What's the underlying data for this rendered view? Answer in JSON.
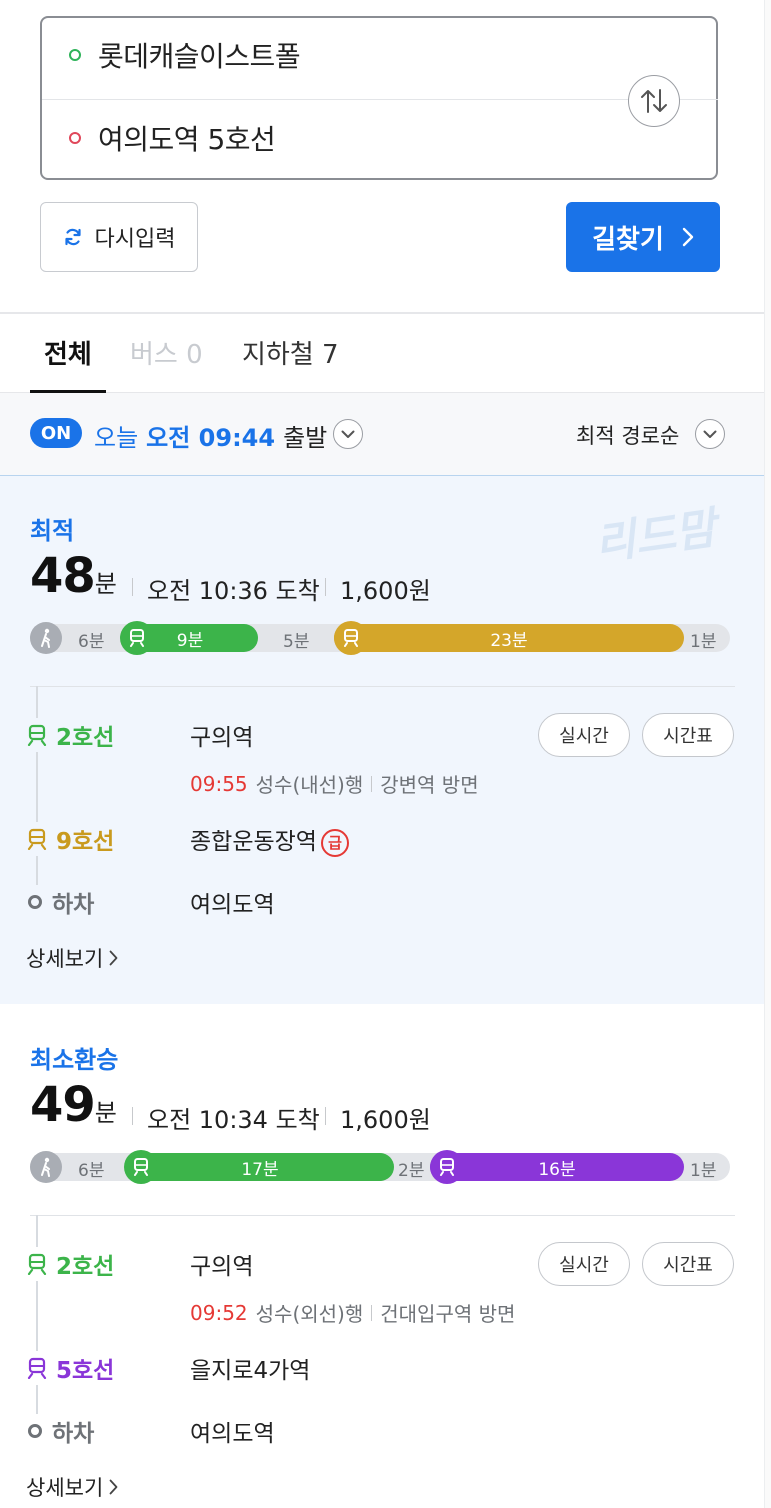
{
  "search": {
    "origin": "롯데캐슬이스트폴",
    "destination": "여의도역 5호선",
    "reset_label": "다시입력",
    "search_label": "길찾기"
  },
  "tabs": [
    {
      "label": "전체",
      "active": true
    },
    {
      "label": "버스 0",
      "active": false,
      "disabled": true
    },
    {
      "label": "지하철 7",
      "active": false
    }
  ],
  "departure": {
    "badge": "ON",
    "day": "오늘",
    "time": "오전 09:44",
    "suffix": "출발",
    "sort": "최적 경로순"
  },
  "watermark": "리드맘",
  "routes": [
    {
      "type": "최적",
      "minutes": "48",
      "unit": "분",
      "arrival": "오전 10:36 도착",
      "fare": "1,600원",
      "timeline": {
        "walk_start": "6분",
        "legs": [
          {
            "line": "2호선",
            "label": "9분",
            "color": "#3cb44a"
          },
          {
            "gap": "5분"
          },
          {
            "line": "9호선",
            "label": "23분",
            "color": "#d4a62a"
          }
        ],
        "walk_end": "1분"
      },
      "steps": [
        {
          "line": "2호선",
          "color": "#3cb44a",
          "station": "구의역",
          "detail_time": "09:55",
          "detail_text": "성수(내선)행",
          "direction": "강변역 방면",
          "realtime": "실시간",
          "timetable": "시간표"
        },
        {
          "line": "9호선",
          "color": "#c99a1e",
          "station": "종합운동장역",
          "express": "급"
        },
        {
          "line": "하차",
          "color": "#6e7277",
          "station": "여의도역"
        }
      ],
      "more": "상세보기"
    },
    {
      "type": "최소환승",
      "minutes": "49",
      "unit": "분",
      "arrival": "오전 10:34 도착",
      "fare": "1,600원",
      "timeline": {
        "walk_start": "6분",
        "legs": [
          {
            "line": "2호선",
            "label": "17분",
            "color": "#3cb44a"
          },
          {
            "gap": "2분"
          },
          {
            "line": "5호선",
            "label": "16분",
            "color": "#8a36d8"
          }
        ],
        "walk_end": "1분"
      },
      "steps": [
        {
          "line": "2호선",
          "color": "#3cb44a",
          "station": "구의역",
          "detail_time": "09:52",
          "detail_text": "성수(외선)행",
          "direction": "건대입구역 방면",
          "realtime": "실시간",
          "timetable": "시간표"
        },
        {
          "line": "5호선",
          "color": "#8a36d8",
          "station": "을지로4가역"
        },
        {
          "line": "하차",
          "color": "#6e7277",
          "station": "여의도역"
        }
      ],
      "more": "상세보기"
    }
  ],
  "colors": {
    "accent": "#1a73e8",
    "time_red": "#e53935"
  }
}
